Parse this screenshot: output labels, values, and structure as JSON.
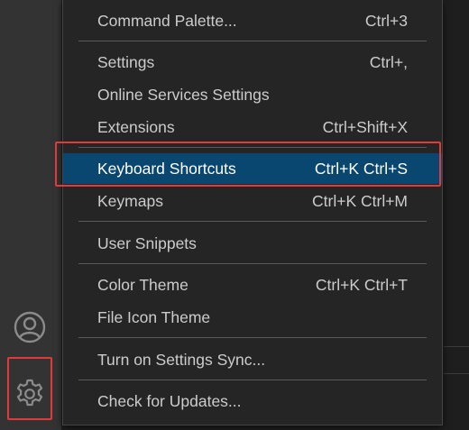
{
  "menu": {
    "items": [
      {
        "label": "Command Palette...",
        "shortcut": "Ctrl+3"
      },
      {
        "label": "Settings",
        "shortcut": "Ctrl+,"
      },
      {
        "label": "Online Services Settings",
        "shortcut": ""
      },
      {
        "label": "Extensions",
        "shortcut": "Ctrl+Shift+X"
      },
      {
        "label": "Keyboard Shortcuts",
        "shortcut": "Ctrl+K Ctrl+S",
        "selected": true
      },
      {
        "label": "Keymaps",
        "shortcut": "Ctrl+K Ctrl+M"
      },
      {
        "label": "User Snippets",
        "shortcut": ""
      },
      {
        "label": "Color Theme",
        "shortcut": "Ctrl+K Ctrl+T"
      },
      {
        "label": "File Icon Theme",
        "shortcut": ""
      },
      {
        "label": "Turn on Settings Sync...",
        "shortcut": ""
      },
      {
        "label": "Check for Updates...",
        "shortcut": ""
      }
    ]
  },
  "activity_bar": {
    "icons": [
      "account-icon",
      "gear-icon"
    ]
  },
  "colors": {
    "menu_background": "#252526",
    "selected_background": "#094771",
    "text": "#cccccc",
    "annotation": "#e03a3a"
  }
}
